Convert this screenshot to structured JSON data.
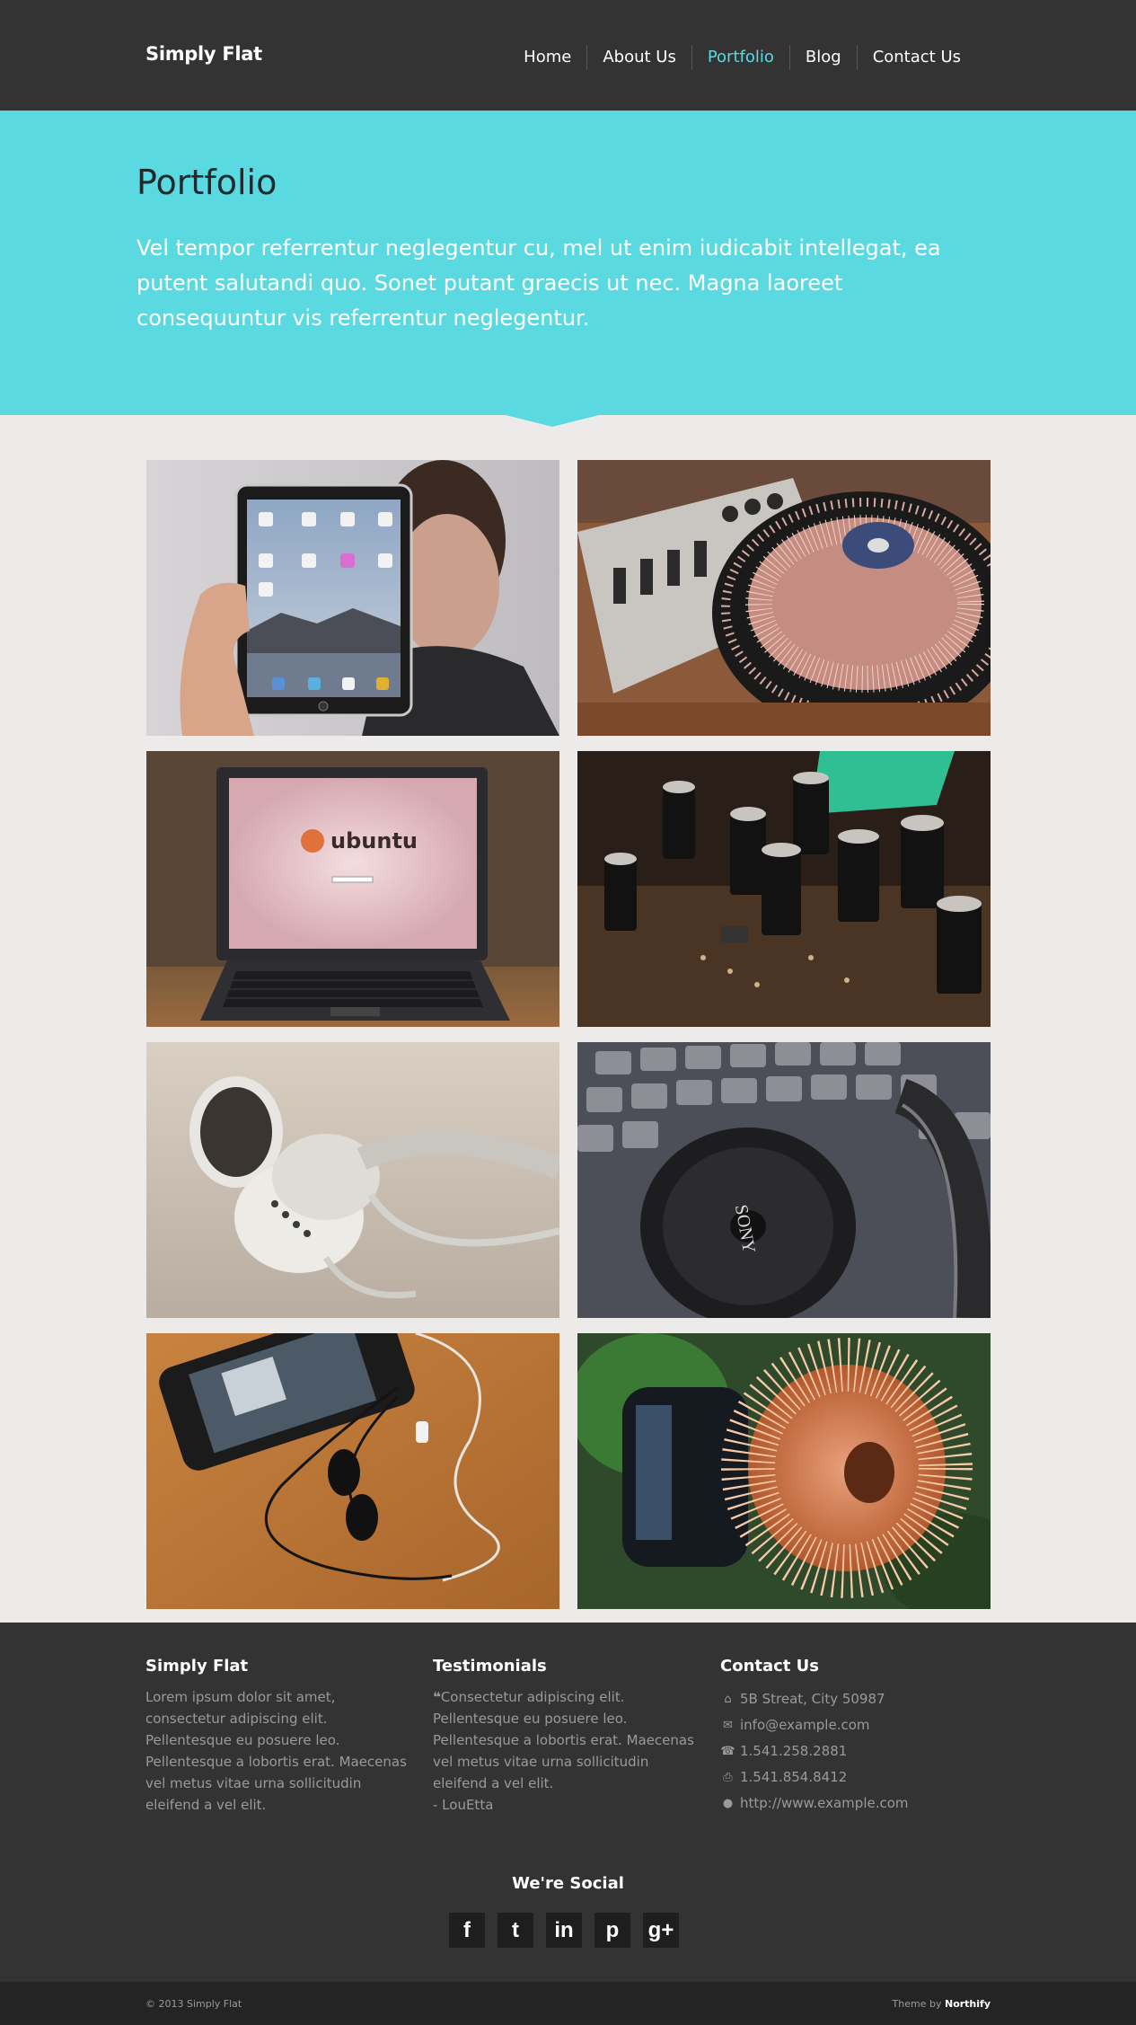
{
  "header": {
    "brand": "Simply Flat",
    "nav": [
      {
        "label": "Home"
      },
      {
        "label": "About Us"
      },
      {
        "label": "Portfolio"
      },
      {
        "label": "Blog"
      },
      {
        "label": "Contact Us"
      }
    ],
    "active_color": "#5bd8e0"
  },
  "hero": {
    "title": "Portfolio",
    "text": "Vel tempor referrentur neglegentur cu, mel ut enim iudicabit intellegat, ea putent salutandi quo. Sonet putant graecis ut nec. Magna laoreet consequuntur vis referrentur neglegentur.",
    "color": "#5bd9e1"
  },
  "gallery": [
    {
      "name": "tablet"
    },
    {
      "name": "turntable"
    },
    {
      "name": "laptop"
    },
    {
      "name": "capacitors"
    },
    {
      "name": "earbuds"
    },
    {
      "name": "headphones"
    },
    {
      "name": "phone-earphones"
    },
    {
      "name": "coil"
    }
  ],
  "footer": {
    "about": {
      "title": "Simply Flat",
      "text": "Lorem ipsum dolor sit amet, consectetur adipiscing elit. Pellentesque eu posuere leo. Pellentesque a lobortis erat. Maecenas vel metus vitae urna sollicitudin eleifend a vel elit."
    },
    "testimonials": {
      "title": "Testimonials",
      "quote_icon": "quote-icon",
      "text": "Consectetur adipiscing elit. Pellentesque eu posuere leo. Pellentesque a lobortis erat. Maecenas vel metus vitae urna sollicitudin eleifend a vel elit.",
      "author": "- LouEtta"
    },
    "contact": {
      "title": "Contact Us",
      "address": "5B Streat, City 50987",
      "email": "info@example.com",
      "phone": "1.541.258.2881",
      "fax": "1.541.854.8412",
      "website": "http://www.example.com"
    },
    "social": {
      "title": "We're Social",
      "items": [
        {
          "icon": "facebook-icon",
          "glyph": "f"
        },
        {
          "icon": "twitter-icon",
          "glyph": "t"
        },
        {
          "icon": "linkedin-icon",
          "glyph": "in"
        },
        {
          "icon": "pinterest-icon",
          "glyph": "p"
        },
        {
          "icon": "google-plus-icon",
          "glyph": "g+"
        }
      ]
    }
  },
  "bottom": {
    "copyright": "© 2013 Simply Flat",
    "credit_prefix": "Theme by",
    "credit_name": "Northify"
  }
}
